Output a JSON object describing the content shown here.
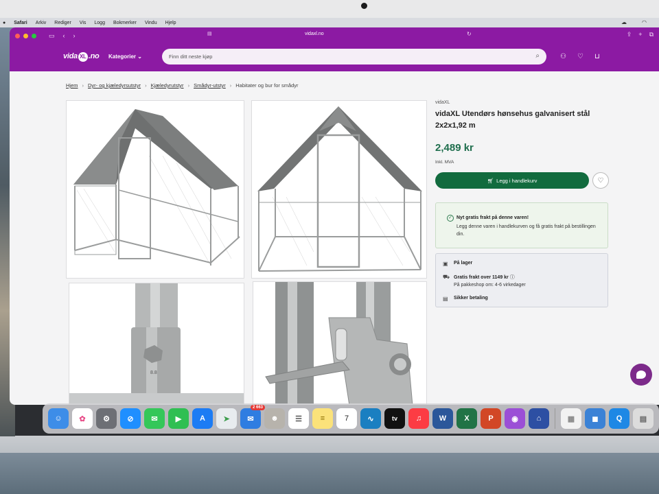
{
  "menubar": {
    "items": [
      "Safari",
      "Arkiv",
      "Rediger",
      "Vis",
      "Logg",
      "Bokmerker",
      "Vindu",
      "Hjelp"
    ]
  },
  "browser": {
    "url": "vidaxl.no"
  },
  "header": {
    "logo_left": "vida",
    "logo_mid": "XL",
    "logo_right": ".no",
    "categories_label": "Kategorier",
    "search_placeholder": "Finn ditt neste kjøp"
  },
  "breadcrumb": {
    "items": [
      "Hjem",
      "Dyr- og kjæledyrsutstyr",
      "Kjæledyrutstyr",
      "Smådyr-utstyr",
      "Habitater og bur for smådyr"
    ]
  },
  "product": {
    "brand": "vidaXL",
    "title": "vidaXL Utendørs hønsehus galvanisert stål 2x2x1,92 m",
    "price": "2,489 kr",
    "vat": "Inkl. MVA",
    "cart_button": "Legg i handlekurv"
  },
  "promo": {
    "title": "Nyt gratis frakt på denne varen!",
    "body": "Legg denne varen i handlekurven og få gratis frakt på bestillingen din."
  },
  "info": {
    "stock": "På lager",
    "shipping": "Gratis frakt over 1149 kr",
    "pickup": "På pakkeshop om: 4-6 virkedager",
    "payment": "Sikker betaling"
  },
  "dock": {
    "mail_badge": "2 663",
    "calendar_day": "7",
    "tv_label": "tv"
  },
  "colors": {
    "brand_purple": "#8c1aa3",
    "price_green": "#1f6e4d",
    "button_green": "#126b3e"
  }
}
